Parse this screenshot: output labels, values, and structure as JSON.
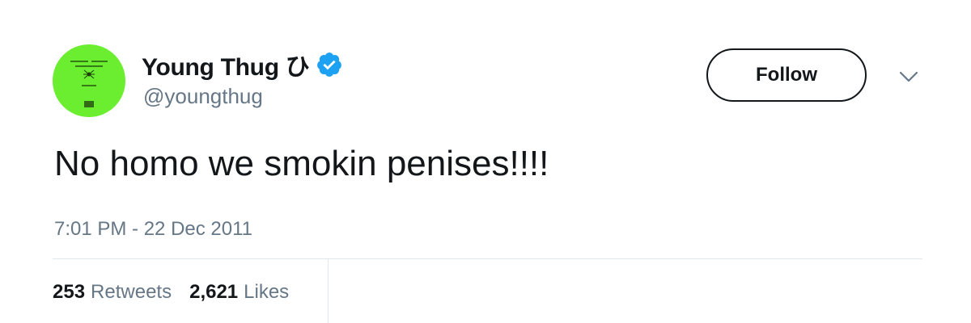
{
  "user": {
    "display_name": "Young Thug ひ",
    "handle": "@youngthug",
    "verified": true,
    "avatar_color": "#6aee2f"
  },
  "follow_button": {
    "label": "Follow"
  },
  "menu": {
    "icon": "chevron-down-icon"
  },
  "tweet": {
    "text": "No homo we smokin penises!!!!",
    "timestamp": "7:01 PM - 22 Dec 2011"
  },
  "stats": {
    "retweets_count": "253",
    "retweets_label": "Retweets",
    "likes_count": "2,621",
    "likes_label": "Likes"
  },
  "colors": {
    "verified_blue": "#1da1f2",
    "secondary_text": "#657786",
    "divider": "#e1e8ed"
  }
}
